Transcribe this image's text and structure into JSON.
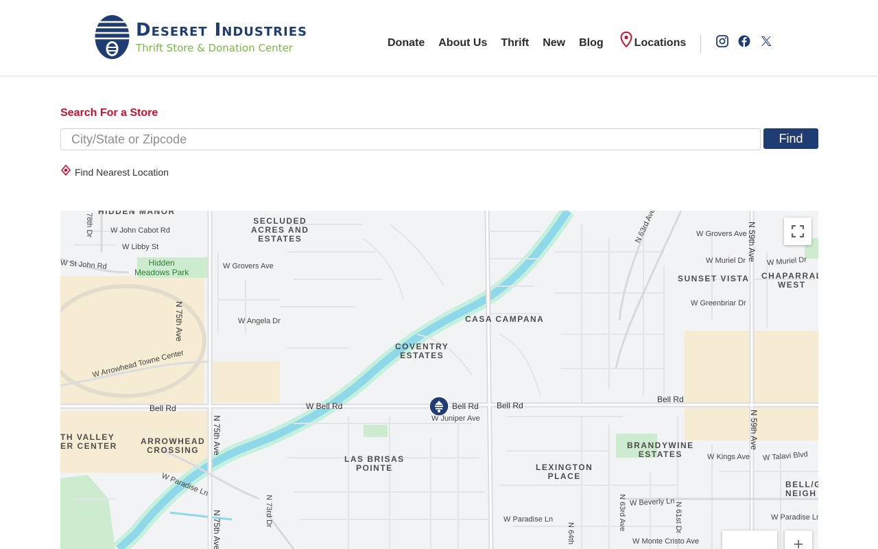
{
  "brand": {
    "title": "Deseret Industries",
    "subtitle": "Thrift Store & Donation Center",
    "navy": "#1f3c73",
    "green": "#7ab648",
    "red": "#c8102e"
  },
  "nav": {
    "items": [
      {
        "label": "Donate"
      },
      {
        "label": "About Us"
      },
      {
        "label": "Thrift"
      },
      {
        "label": "New"
      },
      {
        "label": "Blog"
      }
    ],
    "locations_label": "Locations",
    "locations_icon": "map-pin-icon",
    "social": [
      "instagram-icon",
      "facebook-icon",
      "x-icon"
    ]
  },
  "search": {
    "title": "Search For a Store",
    "placeholder": "City/State or Zipcode",
    "value": "",
    "button_label": "Find",
    "nearest_label": "Find Nearest Location",
    "nearest_icon": "crosshair-icon"
  },
  "map": {
    "areas": {
      "hidden_manor": "HIDDEN MANOR",
      "secluded": [
        "SECLUDED",
        "ACRES AND",
        "ESTATES"
      ],
      "sunset_vista": "SUNSET VISTA",
      "chaparral": [
        "CHAPARRAL",
        "WEST"
      ],
      "casa_campana": "CASA CAMPANA",
      "coventry": [
        "COVENTRY",
        "ESTATES"
      ],
      "valley": [
        "TH VALLEY",
        "ER CENTER"
      ],
      "arrowhead": [
        "ARROWHEAD",
        "CROSSING"
      ],
      "brandywine": [
        "BRANDYWINE",
        "ESTATES"
      ],
      "las_brisas": [
        "LAS BRISAS",
        "POINTE"
      ],
      "lexington": [
        "LEXINGTON",
        "PLACE"
      ],
      "bell_g": [
        "BELL/G",
        "NEIGH"
      ]
    },
    "park": [
      "Hidden",
      "Meadows Park"
    ],
    "roads": {
      "cabot": "W John Cabot Rd",
      "libby": "W Libby St",
      "st_john": "W St John Rd",
      "grovers_w": "W Grovers Ave",
      "grovers_e": "W Grovers Ave",
      "angela": "W Angela Dr",
      "muriel1": "W Muriel Dr",
      "muriel2": "W Muriel Dr",
      "greenbriar": "W Greenbriar Dr",
      "arrowhead_towne": "W Arrowhead Towne Center",
      "bell_left": "Bell Rd",
      "w_bell": "W Bell Rd",
      "bell_mid": "Bell Rd",
      "bell_mid2": "Bell Rd",
      "bell_right": "Bell Rd",
      "juniper": "W Juniper Ave",
      "kings": "W Kings Ave",
      "talavi": "W Talavi Blvd",
      "paradise_left": "W Paradise Ln",
      "paradise_mid": "W Paradise Ln",
      "paradise_right": "W Paradise Ln",
      "beverly": "W Beverly Ln",
      "monte_cristo": "W Monte Cristo Ave",
      "ave75_top": "N 75th Ave",
      "ave75_mid": "N 75th Ave",
      "ave75_bot": "N 75th Ave",
      "ave78": "78th Dr",
      "ave73": "N 73rd Dr",
      "ave63": "N 63rd Ave",
      "ave63b": "N 63rd Ave",
      "ave64": "N 64th",
      "ave61": "N 61st Dr",
      "ave59_top": "N 59th Ave",
      "ave59_mid": "N 59th Ave"
    },
    "controls": {
      "fullscreen_icon": "fullscreen-icon",
      "zoom_icon": "zoom-in-icon"
    }
  }
}
